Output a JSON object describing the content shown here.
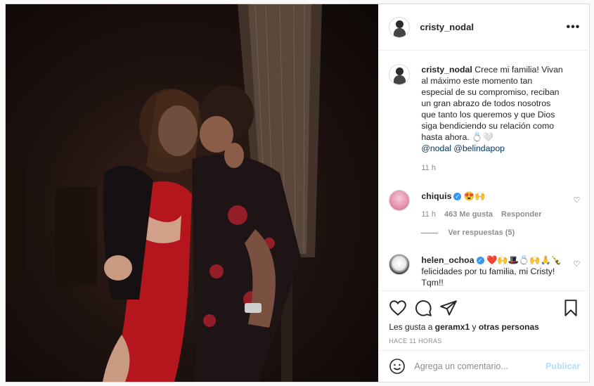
{
  "post": {
    "username": "cristy_nodal",
    "more_label": "•••",
    "caption": {
      "username": "cristy_nodal",
      "text": "Crece mi familia! Vivan al máximo este momento tan especial de su compromiso, reciban un gran abrazo de todos nosotros que tanto los queremos y que Dios siga bendiciendo su relación como hasta ahora. 💍🤍",
      "tags": "@nodal @belindapop",
      "time": "11 h"
    },
    "comments": [
      {
        "username": "chiquis",
        "verified": true,
        "text": "😍🙌",
        "time": "11 h",
        "likes": "463 Me gusta",
        "reply_label": "Responder",
        "view_replies": "Ver respuestas (5)"
      },
      {
        "username": "helen_ochoa",
        "verified": true,
        "text": "❤️🙌🎩💍🙌🙏🍾 felicidades por tu familia, mi Cristy! Tqm!!"
      }
    ],
    "likes_line": {
      "prefix": "Les gusta a",
      "user": "geramx1",
      "middle": "y",
      "others": "otras personas"
    },
    "timestamp": "HACE 11 HORAS",
    "comment_placeholder": "Agrega un comentario...",
    "publish_label": "Publicar",
    "colors": {
      "verified": "#3897f0",
      "link": "#00376b",
      "publish_disabled": "#b2dffc"
    },
    "icons": [
      "heart-icon",
      "comment-icon",
      "share-icon",
      "bookmark-icon",
      "emoji-icon",
      "more-icon"
    ]
  }
}
